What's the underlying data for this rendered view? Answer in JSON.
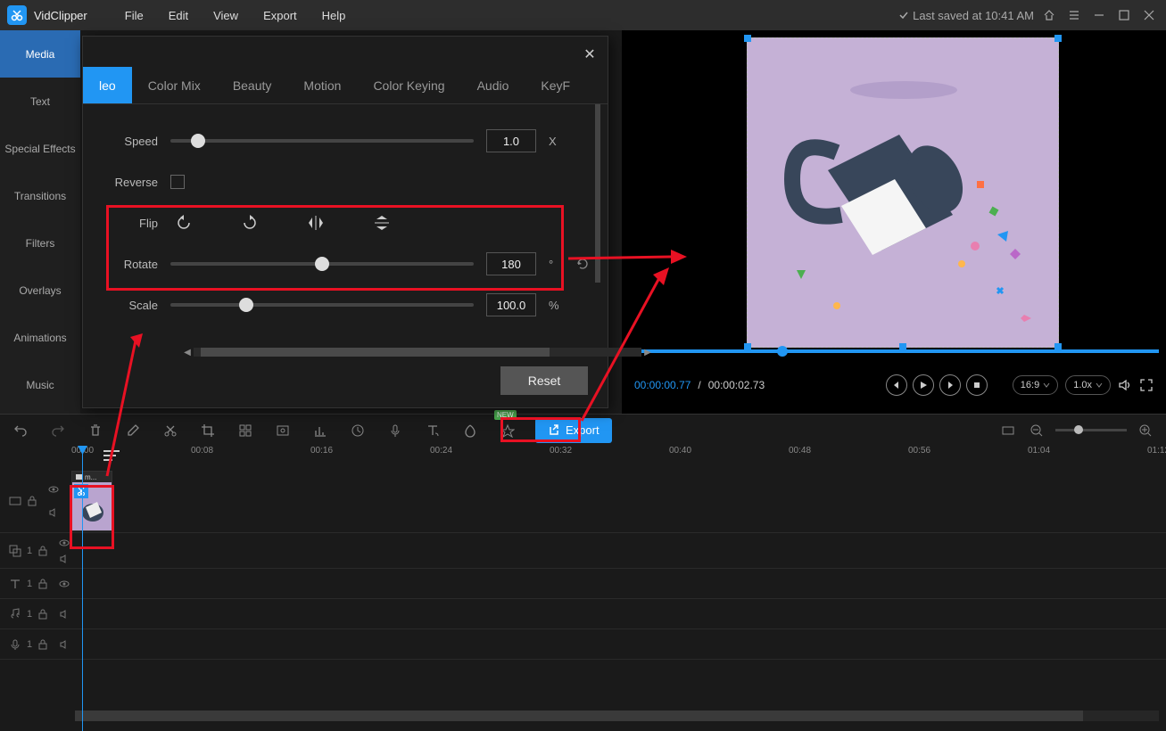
{
  "app": {
    "name": "VidClipper",
    "last_saved": "Last saved at 10:41 AM"
  },
  "menu": {
    "file": "File",
    "edit": "Edit",
    "view": "View",
    "export": "Export",
    "help": "Help"
  },
  "sidebar": {
    "items": [
      "Media",
      "Text",
      "Special Effects",
      "Transitions",
      "Filters",
      "Overlays",
      "Animations",
      "Music"
    ],
    "active": 0
  },
  "panel": {
    "tabs": [
      "Video",
      "Color Mix",
      "Beauty",
      "Motion",
      "Color Keying",
      "Audio",
      "Keyframe"
    ],
    "active_partial": "leo",
    "speed": {
      "label": "Speed",
      "value": "1.0",
      "unit": "X",
      "pct": 9
    },
    "reverse": {
      "label": "Reverse",
      "checked": false
    },
    "flip": {
      "label": "Flip"
    },
    "rotate": {
      "label": "Rotate",
      "value": "180",
      "unit": "°",
      "pct": 50
    },
    "scale": {
      "label": "Scale",
      "value": "100.0",
      "unit": "%",
      "pct": 25
    },
    "reset": "Reset"
  },
  "preview": {
    "current": "00:00:00.77",
    "total": "00:00:02.73",
    "aspect": "16:9",
    "speed": "1.0x"
  },
  "toolbar": {
    "export": "Export",
    "new_badge": "NEW"
  },
  "timeline": {
    "ticks": [
      "00:00",
      "00:08",
      "00:16",
      "00:24",
      "00:32",
      "00:40",
      "00:48",
      "00:56",
      "01:04",
      "01:12"
    ],
    "clip_name": "m...",
    "track_counts": [
      "1",
      "1",
      "1",
      "1"
    ]
  }
}
